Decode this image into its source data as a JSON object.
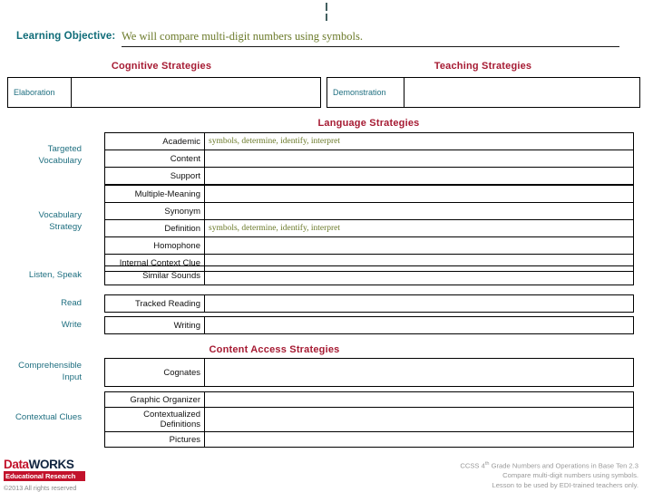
{
  "learning_objective": {
    "label": "Learning Objective:",
    "value": "We will compare multi-digit numbers using symbols."
  },
  "sections": {
    "cognitive": "Cognitive Strategies",
    "teaching": "Teaching Strategies",
    "language": "Language Strategies",
    "content_access": "Content Access Strategies"
  },
  "cognitive_table": {
    "rows": [
      {
        "label": "Elaboration",
        "value": ""
      }
    ]
  },
  "teaching_table": {
    "rows": [
      {
        "label": "Demonstration",
        "value": ""
      }
    ]
  },
  "targeted_vocabulary": {
    "caption": "Targeted\nVocabulary",
    "rows": [
      {
        "label": "Academic",
        "value": "symbols, determine, identify, interpret"
      },
      {
        "label": "Content",
        "value": ""
      },
      {
        "label": "Support",
        "value": ""
      }
    ]
  },
  "vocabulary_strategy": {
    "caption": "Vocabulary\nStrategy",
    "rows": [
      {
        "label": "Multiple-Meaning",
        "value": ""
      },
      {
        "label": "Synonym",
        "value": ""
      },
      {
        "label": "Definition",
        "value": "symbols, determine, identify, interpret"
      },
      {
        "label": "Homophone",
        "value": ""
      },
      {
        "label": "Internal Context Clue",
        "value": ""
      }
    ]
  },
  "listen_speak": {
    "caption": "Listen, Speak",
    "rows": [
      {
        "label": "Similar Sounds",
        "value": ""
      }
    ]
  },
  "read": {
    "caption": "Read",
    "rows": [
      {
        "label": "Tracked Reading",
        "value": ""
      }
    ]
  },
  "write": {
    "caption": "Write",
    "rows": [
      {
        "label": "Writing",
        "value": ""
      }
    ]
  },
  "comprehensible_input": {
    "caption": "Comprehensible\nInput",
    "rows": [
      {
        "label": "Cognates",
        "value": ""
      }
    ]
  },
  "contextual_clues": {
    "caption": "Contextual Clues",
    "rows": [
      {
        "label": "Graphic Organizer",
        "value": ""
      },
      {
        "label": "Contextualized\nDefinitions",
        "value": ""
      },
      {
        "label": "Pictures",
        "value": ""
      }
    ]
  },
  "footer": {
    "logo_data": "Data",
    "logo_works": "WORKS",
    "logo_tagline": "Educational Research",
    "copyright": "©2013 All rights reserved",
    "credit_line1": "CCSS 4",
    "credit_line1_sup": "th",
    "credit_line1_rest": " Grade Numbers and Operations in Base Ten 2.3",
    "credit_line2": "Compare multi-digit numbers using symbols.",
    "credit_line3": "Lesson to be used by EDI-trained teachers only."
  },
  "colors": {
    "heading_red": "#a61b33",
    "teal": "#1f6f80",
    "olive": "#6b7a2a",
    "logo_red": "#c2122b",
    "logo_navy": "#10243f"
  }
}
